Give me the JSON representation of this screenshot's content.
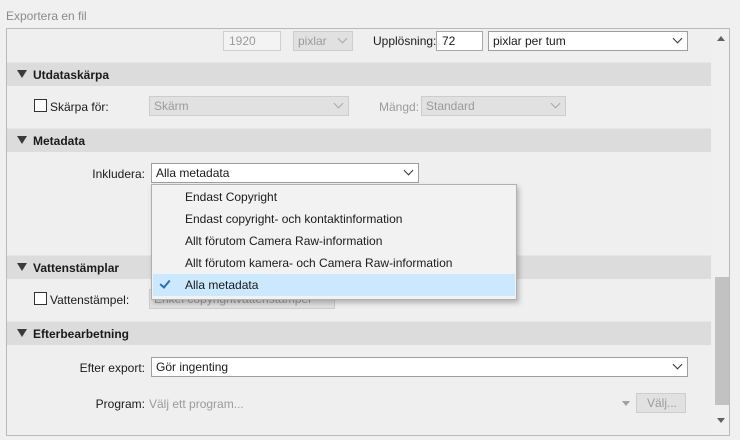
{
  "window": {
    "title": "Exportera en fil"
  },
  "size": {
    "width_value": "1920",
    "unit": "pixlar",
    "resolution_label": "Upplösning:",
    "resolution_value": "72",
    "resolution_unit": "pixlar per tum"
  },
  "sharpening": {
    "header": "Utdataskärpa",
    "checkbox_label": "Skärpa för:",
    "target_value": "Skärm",
    "amount_label": "Mängd:",
    "amount_value": "Standard"
  },
  "metadata": {
    "header": "Metadata",
    "include_label": "Inkludera:",
    "include_value": "Alla metadata",
    "options": [
      {
        "label": "Endast Copyright",
        "selected": false
      },
      {
        "label": "Endast copyright- och kontaktinformation",
        "selected": false
      },
      {
        "label": "Allt förutom Camera Raw-information",
        "selected": false
      },
      {
        "label": "Allt förutom kamera- och Camera Raw-information",
        "selected": false
      },
      {
        "label": "Alla metadata",
        "selected": true
      }
    ]
  },
  "watermark": {
    "header": "Vattenstämplar",
    "checkbox_label": "Vattenstämpel:",
    "value": "Enkel copyrightvattenstämpel"
  },
  "post_processing": {
    "header": "Efterbearbetning",
    "after_export_label": "Efter export:",
    "after_export_value": "Gör ingenting",
    "program_label": "Program:",
    "program_placeholder": "Välj ett program...",
    "choose_button": "Välj..."
  }
}
